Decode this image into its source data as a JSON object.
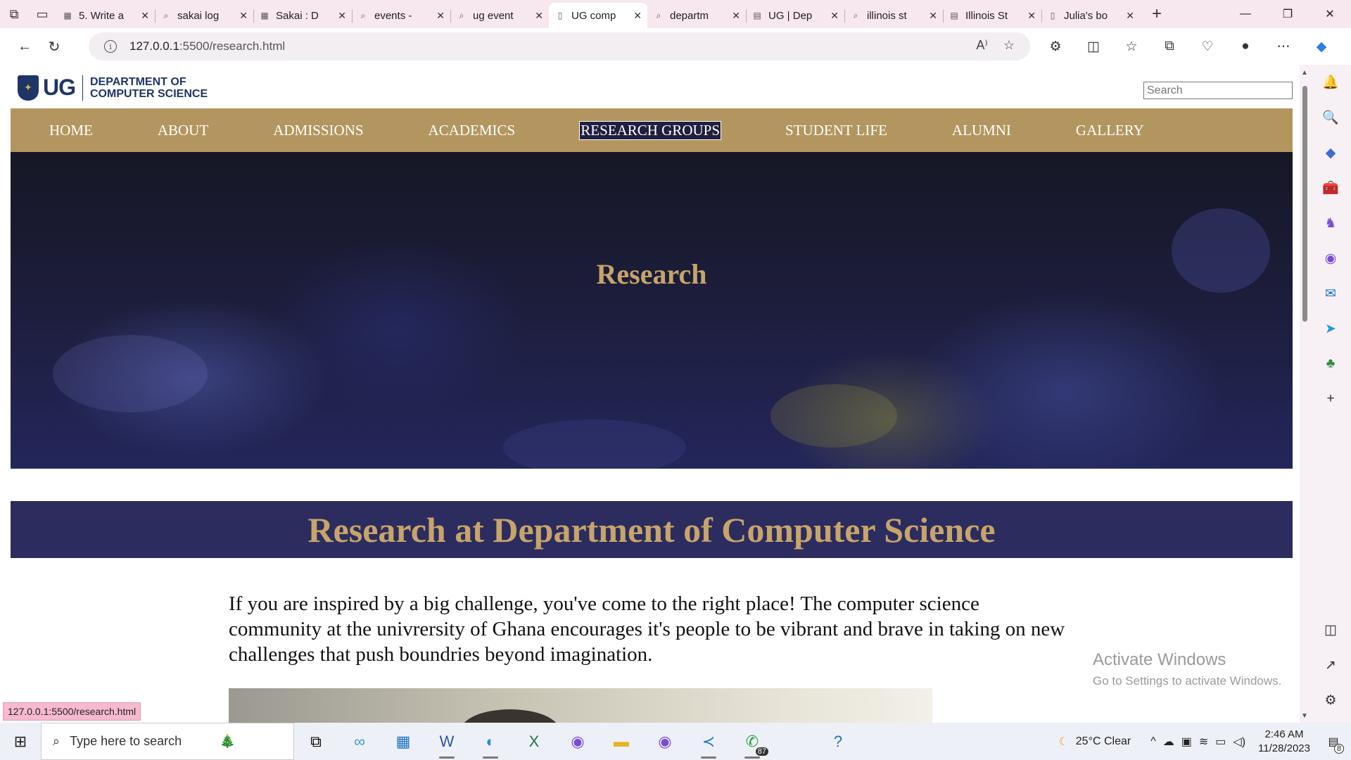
{
  "browser": {
    "tabs": [
      {
        "title": "5. Write a",
        "icon": "sakai-icon",
        "active": false
      },
      {
        "title": "sakai log",
        "icon": "search-icon",
        "active": false
      },
      {
        "title": "Sakai : D",
        "icon": "sakai-icon",
        "active": false
      },
      {
        "title": "events -",
        "icon": "search-icon",
        "active": false
      },
      {
        "title": "ug event",
        "icon": "search-icon",
        "active": false
      },
      {
        "title": "UG comp",
        "icon": "page-icon",
        "active": true
      },
      {
        "title": "departm",
        "icon": "search-icon",
        "active": false
      },
      {
        "title": "UG | Dep",
        "icon": "site-icon",
        "active": false
      },
      {
        "title": "illinois st",
        "icon": "search-icon",
        "active": false
      },
      {
        "title": "Illinois St",
        "icon": "site-icon",
        "active": false
      },
      {
        "title": "Julia's bo",
        "icon": "page-icon",
        "active": false
      }
    ],
    "address": {
      "host": "127.0.0.1",
      "rest": ":5500/research.html"
    },
    "status_url": "127.0.0.1:5500/research.html"
  },
  "site": {
    "logo_text": "UG",
    "dept_line1": "DEPARTMENT OF",
    "dept_line2": "COMPUTER SCIENCE",
    "search_placeholder": "Search",
    "menu": [
      "HOME",
      "ABOUT",
      "ADMISSIONS",
      "ACADEMICS",
      "RESEARCH GROUPS",
      "STUDENT LIFE",
      "ALUMNI",
      "GALLERY"
    ],
    "hero_title": "Research",
    "banner_title": "Research at Department of Computer Science",
    "intro": "If you are inspired by a big challenge, you've come to the right place! The computer science community at the univrersity of Ghana encourages it's people to be vibrant and brave in taking on new challenges that push boundries beyond imagination."
  },
  "watermark": {
    "line1": "Activate Windows",
    "line2": "Go to Settings to activate Windows."
  },
  "taskbar": {
    "search_placeholder": "Type here to search",
    "whatsapp_badge": "87",
    "weather": "25°C  Clear",
    "time": "2:46 AM",
    "date": "11/28/2023",
    "notifications": "8"
  },
  "colors": {
    "nav_gold": "#b3965f",
    "heading_gold": "#c6a46a",
    "banner_navy": "#2c2c5e",
    "brand_navy": "#1f3566"
  }
}
